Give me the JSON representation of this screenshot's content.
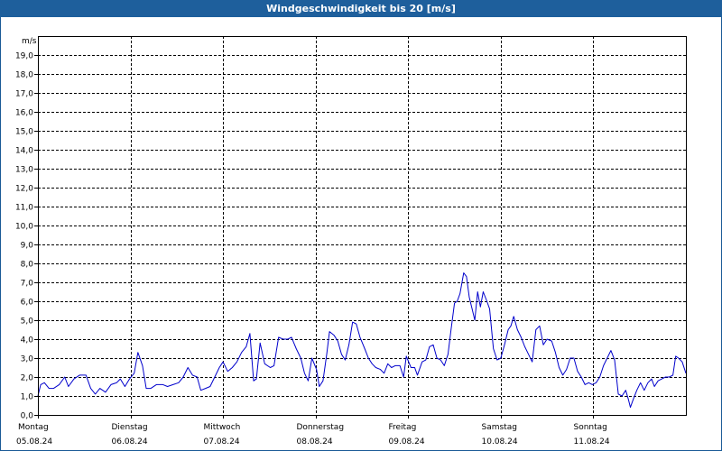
{
  "window": {
    "title": "Windgeschwindigkeit bis 20 [m/s]"
  },
  "colors": {
    "title_bg": "#1e5f9c",
    "line": "#0000cc",
    "grid": "#000000"
  },
  "chart_data": {
    "type": "line",
    "title": "Windgeschwindigkeit bis 20 [m/s]",
    "ylabel": "m/s",
    "xlabel": "",
    "ylim": [
      0,
      20
    ],
    "yticks": [
      "0,0",
      "1,0",
      "2,0",
      "3,0",
      "4,0",
      "5,0",
      "6,0",
      "7,0",
      "8,0",
      "9,0",
      "10,0",
      "11,0",
      "12,0",
      "13,0",
      "14,0",
      "15,0",
      "16,0",
      "17,0",
      "18,0",
      "19,0"
    ],
    "x_unit": "days since 05.08.24 00:00",
    "xlim": [
      0,
      7
    ],
    "grid": true,
    "days": [
      {
        "weekday": "Montag",
        "date": "05.08.24"
      },
      {
        "weekday": "Dienstag",
        "date": "06.08.24"
      },
      {
        "weekday": "Mittwoch",
        "date": "07.08.24"
      },
      {
        "weekday": "Donnerstag",
        "date": "08.08.24"
      },
      {
        "weekday": "Freitag",
        "date": "09.08.24"
      },
      {
        "weekday": "Samstag",
        "date": "10.08.24"
      },
      {
        "weekday": "Sonntag",
        "date": "11.08.24"
      }
    ],
    "series": [
      {
        "name": "",
        "points": [
          [
            0.0,
            1.0
          ],
          [
            0.03,
            1.6
          ],
          [
            0.07,
            1.7
          ],
          [
            0.12,
            1.4
          ],
          [
            0.17,
            1.4
          ],
          [
            0.23,
            1.6
          ],
          [
            0.29,
            2.0
          ],
          [
            0.33,
            1.5
          ],
          [
            0.39,
            1.9
          ],
          [
            0.45,
            2.1
          ],
          [
            0.52,
            2.1
          ],
          [
            0.57,
            1.4
          ],
          [
            0.62,
            1.1
          ],
          [
            0.67,
            1.4
          ],
          [
            0.73,
            1.2
          ],
          [
            0.79,
            1.6
          ],
          [
            0.85,
            1.7
          ],
          [
            0.89,
            1.9
          ],
          [
            0.94,
            1.5
          ],
          [
            0.99,
            1.9
          ],
          [
            1.04,
            2.2
          ],
          [
            1.08,
            3.3
          ],
          [
            1.13,
            2.6
          ],
          [
            1.17,
            1.4
          ],
          [
            1.22,
            1.4
          ],
          [
            1.28,
            1.6
          ],
          [
            1.35,
            1.6
          ],
          [
            1.4,
            1.5
          ],
          [
            1.46,
            1.6
          ],
          [
            1.52,
            1.7
          ],
          [
            1.57,
            2.0
          ],
          [
            1.62,
            2.5
          ],
          [
            1.67,
            2.1
          ],
          [
            1.72,
            2.0
          ],
          [
            1.76,
            1.3
          ],
          [
            1.81,
            1.4
          ],
          [
            1.86,
            1.5
          ],
          [
            1.9,
            1.9
          ],
          [
            1.96,
            2.5
          ],
          [
            2.0,
            2.8
          ],
          [
            2.05,
            2.3
          ],
          [
            2.1,
            2.5
          ],
          [
            2.15,
            2.8
          ],
          [
            2.2,
            3.3
          ],
          [
            2.25,
            3.6
          ],
          [
            2.29,
            4.3
          ],
          [
            2.33,
            1.8
          ],
          [
            2.36,
            1.9
          ],
          [
            2.4,
            3.8
          ],
          [
            2.45,
            2.7
          ],
          [
            2.51,
            2.5
          ],
          [
            2.55,
            2.6
          ],
          [
            2.6,
            4.1
          ],
          [
            2.65,
            4.0
          ],
          [
            2.7,
            4.0
          ],
          [
            2.74,
            4.1
          ],
          [
            2.79,
            3.5
          ],
          [
            2.84,
            3.0
          ],
          [
            2.88,
            2.2
          ],
          [
            2.92,
            1.8
          ],
          [
            2.96,
            3.0
          ],
          [
            3.01,
            2.4
          ],
          [
            3.04,
            1.5
          ],
          [
            3.08,
            1.8
          ],
          [
            3.12,
            3.2
          ],
          [
            3.15,
            4.4
          ],
          [
            3.2,
            4.2
          ],
          [
            3.24,
            3.9
          ],
          [
            3.28,
            3.2
          ],
          [
            3.32,
            2.9
          ],
          [
            3.36,
            3.7
          ],
          [
            3.4,
            4.9
          ],
          [
            3.44,
            4.8
          ],
          [
            3.48,
            4.1
          ],
          [
            3.53,
            3.5
          ],
          [
            3.57,
            3.0
          ],
          [
            3.61,
            2.7
          ],
          [
            3.65,
            2.5
          ],
          [
            3.7,
            2.4
          ],
          [
            3.74,
            2.2
          ],
          [
            3.78,
            2.7
          ],
          [
            3.82,
            2.5
          ],
          [
            3.86,
            2.6
          ],
          [
            3.91,
            2.6
          ],
          [
            3.95,
            2.0
          ],
          [
            3.98,
            3.1
          ],
          [
            4.03,
            2.5
          ],
          [
            4.07,
            2.5
          ],
          [
            4.1,
            2.1
          ],
          [
            4.15,
            2.8
          ],
          [
            4.19,
            2.9
          ],
          [
            4.23,
            3.6
          ],
          [
            4.27,
            3.7
          ],
          [
            4.31,
            3.0
          ],
          [
            4.35,
            2.9
          ],
          [
            4.39,
            2.6
          ],
          [
            4.43,
            3.2
          ],
          [
            4.46,
            4.4
          ],
          [
            4.5,
            5.9
          ],
          [
            4.53,
            6.0
          ],
          [
            4.56,
            6.4
          ],
          [
            4.6,
            7.5
          ],
          [
            4.63,
            7.3
          ],
          [
            4.66,
            6.2
          ],
          [
            4.69,
            5.6
          ],
          [
            4.72,
            5.0
          ],
          [
            4.75,
            6.5
          ],
          [
            4.78,
            5.7
          ],
          [
            4.81,
            6.5
          ],
          [
            4.85,
            6.0
          ],
          [
            4.88,
            5.6
          ],
          [
            4.92,
            3.5
          ],
          [
            4.96,
            2.9
          ],
          [
            5.0,
            3.0
          ],
          [
            5.04,
            3.7
          ],
          [
            5.08,
            4.5
          ],
          [
            5.11,
            4.7
          ],
          [
            5.14,
            5.2
          ],
          [
            5.18,
            4.5
          ],
          [
            5.22,
            4.1
          ],
          [
            5.26,
            3.6
          ],
          [
            5.3,
            3.2
          ],
          [
            5.34,
            2.8
          ],
          [
            5.38,
            4.5
          ],
          [
            5.42,
            4.7
          ],
          [
            5.46,
            3.7
          ],
          [
            5.5,
            4.0
          ],
          [
            5.55,
            3.9
          ],
          [
            5.59,
            3.3
          ],
          [
            5.63,
            2.5
          ],
          [
            5.67,
            2.1
          ],
          [
            5.71,
            2.4
          ],
          [
            5.75,
            3.0
          ],
          [
            5.79,
            3.0
          ],
          [
            5.83,
            2.3
          ],
          [
            5.87,
            2.0
          ],
          [
            5.91,
            1.6
          ],
          [
            5.95,
            1.7
          ],
          [
            5.99,
            1.6
          ],
          [
            6.03,
            1.7
          ],
          [
            6.07,
            2.0
          ],
          [
            6.11,
            2.6
          ],
          [
            6.15,
            3.0
          ],
          [
            6.19,
            3.4
          ],
          [
            6.23,
            2.9
          ],
          [
            6.27,
            1.1
          ],
          [
            6.31,
            1.0
          ],
          [
            6.35,
            1.3
          ],
          [
            6.38,
            0.8
          ],
          [
            6.4,
            0.4
          ],
          [
            6.43,
            0.8
          ],
          [
            6.47,
            1.3
          ],
          [
            6.51,
            1.7
          ],
          [
            6.55,
            1.3
          ],
          [
            6.59,
            1.7
          ],
          [
            6.63,
            1.9
          ],
          [
            6.66,
            1.5
          ],
          [
            6.7,
            1.8
          ],
          [
            6.74,
            1.9
          ],
          [
            6.78,
            2.0
          ],
          [
            6.82,
            2.0
          ],
          [
            6.86,
            2.1
          ],
          [
            6.89,
            3.1
          ],
          [
            6.92,
            3.0
          ],
          [
            6.96,
            2.8
          ],
          [
            7.0,
            2.2
          ]
        ]
      }
    ]
  }
}
